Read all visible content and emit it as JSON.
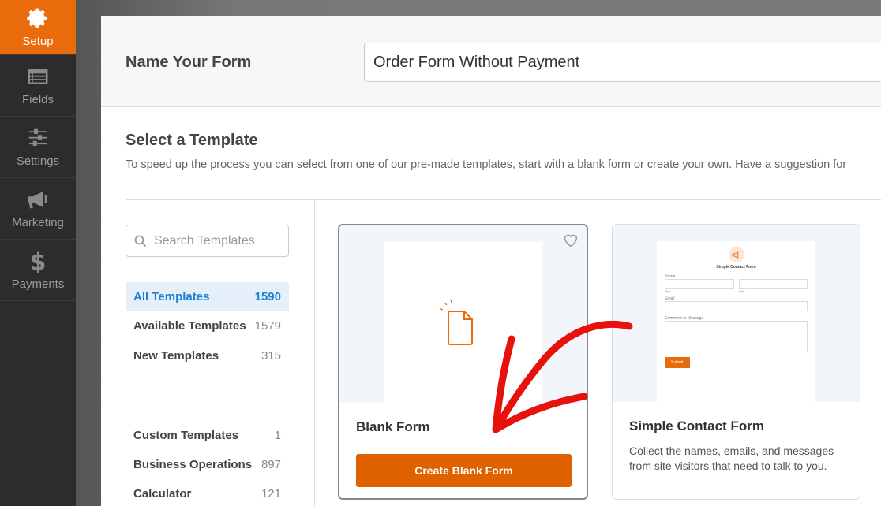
{
  "sidebar": {
    "items": [
      {
        "label": "Setup",
        "icon": "gear-icon"
      },
      {
        "label": "Fields",
        "icon": "list-icon"
      },
      {
        "label": "Settings",
        "icon": "sliders-icon"
      },
      {
        "label": "Marketing",
        "icon": "megaphone-icon"
      },
      {
        "label": "Payments",
        "icon": "dollar-icon"
      }
    ]
  },
  "header": {
    "label": "Name Your Form",
    "form_name": "Order Form Without Payment"
  },
  "select": {
    "title": "Select a Template",
    "desc_pre": "To speed up the process you can select from one of our pre-made templates, start with a ",
    "blank_link": "blank form",
    "desc_mid": " or ",
    "own_link": "create your own",
    "desc_post": ". Have a suggestion for"
  },
  "search": {
    "placeholder": "Search Templates"
  },
  "categories": [
    {
      "label": "All Templates",
      "count": "1590"
    },
    {
      "label": "Available Templates",
      "count": "1579"
    },
    {
      "label": "New Templates",
      "count": "315"
    },
    {
      "label": "Custom Templates",
      "count": "1"
    },
    {
      "label": "Business Operations",
      "count": "897"
    },
    {
      "label": "Calculator",
      "count": "121"
    }
  ],
  "cards": [
    {
      "title": "Blank Form",
      "button": "Create Blank Form"
    },
    {
      "title": "Simple Contact Form",
      "desc": "Collect the names, emails, and messages from site visitors that need to talk to you.",
      "preview": {
        "title": "Simple Contact Form",
        "name": "Name",
        "first": "First",
        "last": "Last",
        "email": "Email",
        "message": "Comment or Message",
        "submit": "Submit"
      }
    }
  ],
  "colors": {
    "accent": "#e96b0b",
    "arrow": "#e8120c",
    "link_blue": "#1f7fd0"
  }
}
